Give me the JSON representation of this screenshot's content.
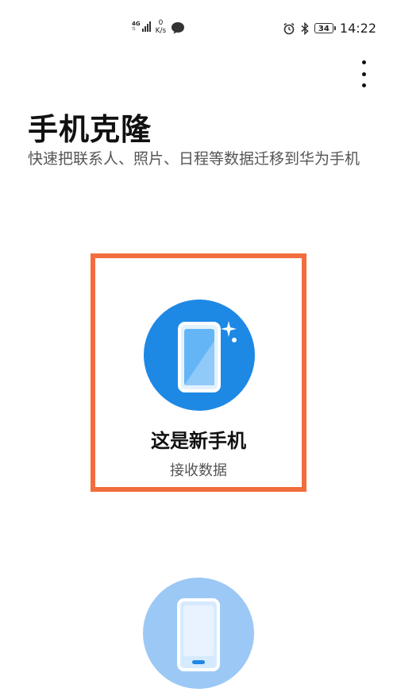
{
  "status_bar": {
    "network_type": "4G",
    "speed_value": "0",
    "speed_unit": "K/s",
    "battery_level": "34",
    "time": "14:22"
  },
  "header": {
    "title": "手机克隆",
    "subtitle": "快速把联系人、照片、日程等数据迁移到华为手机"
  },
  "options": {
    "new_phone": {
      "title": "这是新手机",
      "subtitle": "接收数据",
      "icon": "new-phone-icon",
      "circle_color": "#1e88e5"
    },
    "old_phone": {
      "icon": "old-phone-icon",
      "circle_color": "#9cc8f5"
    }
  },
  "colors": {
    "highlight_border": "#f26d3d",
    "accent": "#1e88e5"
  }
}
